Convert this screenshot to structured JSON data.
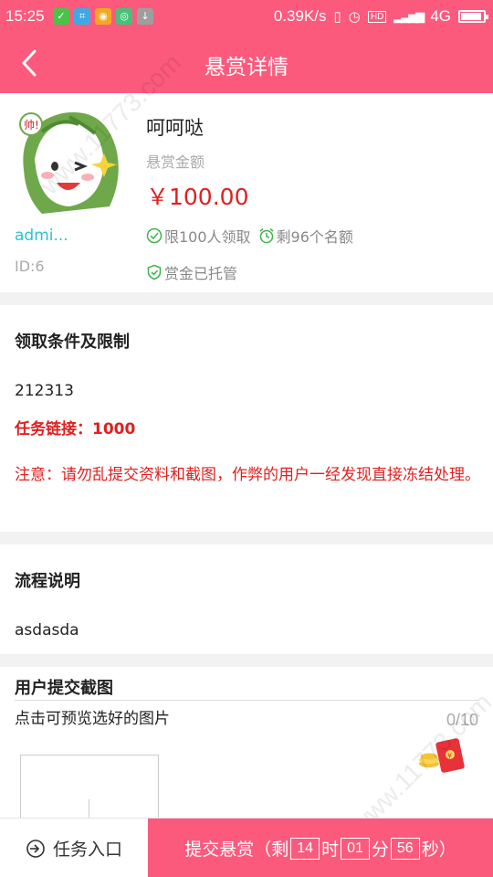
{
  "status_bar": {
    "time": "15:25",
    "network_speed": "0.39K/s",
    "network_type": "4G",
    "notification_icons": [
      "wechat-icon",
      "scan-icon",
      "app-icon",
      "signal-app-icon",
      "download-icon"
    ]
  },
  "header": {
    "title": "悬赏详情",
    "back_icon": "back-arrow-icon",
    "bg_color": "#fb5a7d"
  },
  "profile": {
    "avatar_badge": "帅!",
    "username": "admi...",
    "user_id": "ID:6",
    "task_title": "呵呵哒",
    "amount_label": "悬赏金额",
    "amount": "￥100.00",
    "limit_text": "限100人领取",
    "remaining_text": "剩96个名额",
    "escrow_text": "赏金已托管"
  },
  "conditions": {
    "title": "领取条件及限制",
    "content": "212313",
    "task_link": "任务链接：1000",
    "notice": "注意：请勿乱提交资料和截图，作弊的用户一经发现直接冻结处理。"
  },
  "process": {
    "title": "流程说明",
    "content": "asdasda"
  },
  "screenshots": {
    "title": "用户提交截图",
    "hint": "点击可预览选好的图片",
    "counter": "0/10"
  },
  "bottom_bar": {
    "task_entry_label": "任务入口",
    "submit_prefix": "提交悬赏（剩",
    "hours": "14",
    "hours_unit": "时",
    "minutes": "01",
    "minutes_unit": "分",
    "seconds": "56",
    "seconds_unit": "秒）"
  },
  "colors": {
    "accent": "#fb5a7d",
    "price_red": "#e02020",
    "link_cyan": "#29c3d5",
    "check_green": "#3bb54a"
  }
}
